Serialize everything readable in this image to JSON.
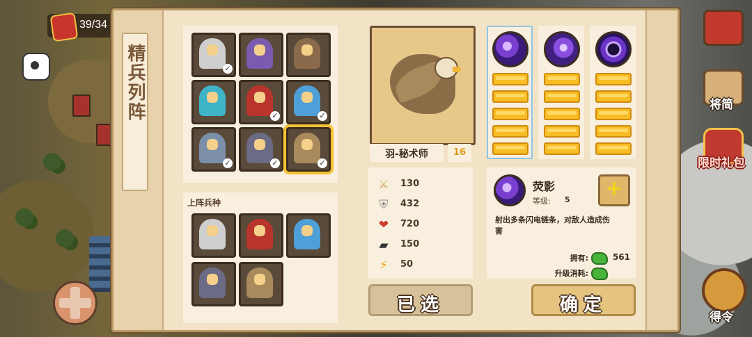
{
  "hud": {
    "counter": "39/34",
    "side_menu": [
      {
        "id": "shop",
        "label": ""
      },
      {
        "id": "generals",
        "label": "将简"
      },
      {
        "id": "gift",
        "label": "限时礼包"
      },
      {
        "id": "order",
        "label": "得令"
      }
    ]
  },
  "panel": {
    "title": "精兵列阵",
    "lineup_title": "上阵兵种",
    "roster": [
      {
        "name": "white-knight",
        "color": "#cfcfcf",
        "checked": true
      },
      {
        "name": "purple-mage",
        "color": "#7b5bb0",
        "checked": false
      },
      {
        "name": "cannon",
        "color": "#8a6a4a",
        "checked": false
      },
      {
        "name": "cyan-dragon",
        "color": "#3fb3c8",
        "checked": false
      },
      {
        "name": "red-knight",
        "color": "#b8342c",
        "checked": true
      },
      {
        "name": "blue-knight",
        "color": "#4f9fd8",
        "checked": true
      },
      {
        "name": "silver-knight",
        "color": "#7b8fa8",
        "checked": true
      },
      {
        "name": "dark-knight",
        "color": "#6b6b85",
        "checked": true
      },
      {
        "name": "feather-mage",
        "color": "#a88a5d",
        "checked": true
      }
    ],
    "lineup": [
      {
        "name": "white-knight",
        "color": "#cfcfcf"
      },
      {
        "name": "red-knight",
        "color": "#b8342c"
      },
      {
        "name": "blue-knight",
        "color": "#4f9fd8"
      },
      {
        "name": "dark-knight",
        "color": "#6b6b85"
      },
      {
        "name": "feather-mage",
        "color": "#a88a5d"
      }
    ],
    "selected_unit": {
      "name": "羽-秘术师",
      "level": "16",
      "stats": [
        {
          "icon": "sword-icon",
          "glyph": "⚔",
          "value": "130",
          "color": "#c9a24a"
        },
        {
          "icon": "shield-icon",
          "glyph": "⛨",
          "value": "432",
          "color": "#8a8a8a"
        },
        {
          "icon": "heart-icon",
          "glyph": "❤",
          "value": "720",
          "color": "#c8402f"
        },
        {
          "icon": "boot-icon",
          "glyph": "▰",
          "value": "150",
          "color": "#333333"
        },
        {
          "icon": "lightning-icon",
          "glyph": "⚡",
          "value": "50",
          "color": "#e7a81c"
        }
      ]
    },
    "skills": [
      {
        "orb": "",
        "bars": 5,
        "active": true
      },
      {
        "orb": "b2",
        "bars": 5,
        "active": false
      },
      {
        "orb": "b3",
        "bars": 5,
        "active": false
      }
    ],
    "skill_detail": {
      "name": "荧影",
      "level_label": "等级:",
      "level": "5",
      "description": "射出多条闪电链条，对敌人造成伤害",
      "own_label": "拥有:",
      "own_value": "561",
      "cost_label": "升级消耗:"
    },
    "buttons": {
      "selected": "已选",
      "confirm": "确定"
    }
  }
}
